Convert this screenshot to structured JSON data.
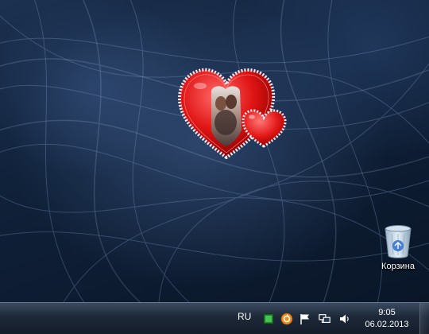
{
  "desktop": {
    "icons": [
      {
        "label": "Корзина",
        "icon": "recycle-bin-icon"
      }
    ],
    "gadget": {
      "type": "heart-photo-frame",
      "icon": "heart-frame-icon"
    }
  },
  "taskbar": {
    "language": "RU",
    "tray_icons": [
      "green-app-icon",
      "orange-updater-icon",
      "action-center-flag-icon",
      "network-icon",
      "volume-icon"
    ],
    "clock": {
      "time": "9:05",
      "date": "06.02.2013"
    }
  }
}
